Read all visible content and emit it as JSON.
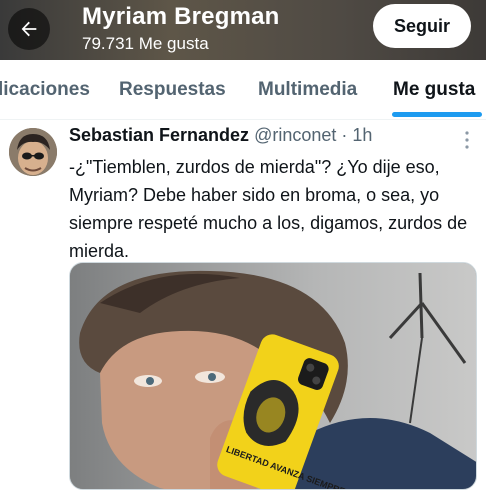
{
  "header": {
    "title": "Myriam Bregman",
    "likes_count": "79.731 Me gusta",
    "follow_label": "Seguir",
    "back_icon": "arrow-left-icon"
  },
  "tabs": [
    {
      "label": "licaciones",
      "active": false
    },
    {
      "label": "Respuestas",
      "active": false
    },
    {
      "label": "Multimedia",
      "active": false
    },
    {
      "label": "Me gusta",
      "active": true
    }
  ],
  "tweet": {
    "author_name": "Sebastian Fernandez",
    "author_handle": "@rinconet",
    "separator": "·",
    "time": "1h",
    "text": "-¿\"Tiemblen, zurdos de mierda\"? ¿Yo dije eso, Myriam? Debe haber sido en broma, o sea, yo siempre respeté mucho a los, digamos, zurdos de mierda.",
    "more_icon": "more-vertical-icon",
    "media_alt": "photo",
    "phone_case_text": "LIBERTAD AVANZA SIEMPRE"
  },
  "colors": {
    "accent": "#1d9bf0",
    "text_primary": "#0f1419",
    "text_secondary": "#536471",
    "phone_case": "#f2d21a"
  }
}
